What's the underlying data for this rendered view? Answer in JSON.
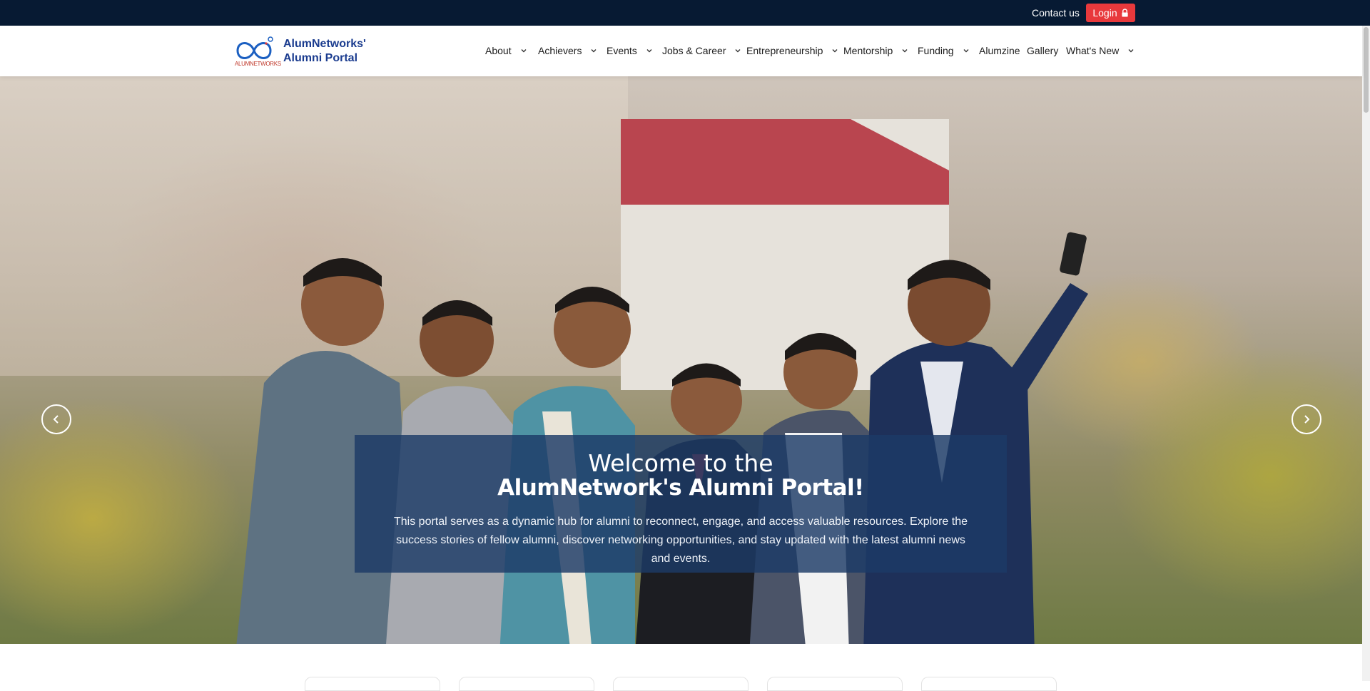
{
  "topbar": {
    "contact_label": "Contact us",
    "login_label": "Login"
  },
  "brand": {
    "line1": "AlumNetworks'",
    "line2": "Alumni Portal",
    "mark_text": "ALUMNETWORKS"
  },
  "nav": {
    "items": [
      {
        "label": "About",
        "has_dropdown": true
      },
      {
        "label": "Achievers",
        "has_dropdown": true
      },
      {
        "label": "Events",
        "has_dropdown": true
      },
      {
        "label": "Jobs & Career",
        "has_dropdown": true
      },
      {
        "label": "Entrepreneurship",
        "has_dropdown": true
      },
      {
        "label": "Mentorship",
        "has_dropdown": true
      },
      {
        "label": "Funding",
        "has_dropdown": true
      },
      {
        "label": "Alumzine",
        "has_dropdown": false
      },
      {
        "label": "Gallery",
        "has_dropdown": false
      },
      {
        "label": "What's New",
        "has_dropdown": true
      }
    ]
  },
  "hero": {
    "title_line1": "Welcome to the",
    "title_line2": "AlumNetwork's Alumni Portal!",
    "description": "This portal serves as a dynamic hub for alumni to reconnect, engage, and access valuable resources. Explore the success stories of fellow alumni, discover networking opportunities, and stay updated with the latest alumni news and events.",
    "prev_icon": "chevron-left-icon",
    "next_icon": "chevron-right-icon"
  },
  "colors": {
    "topbar_bg": "#071a33",
    "login_bg": "#e8393c",
    "brand_text": "#1b3c8f",
    "caption_bg": "#1c3a66"
  }
}
